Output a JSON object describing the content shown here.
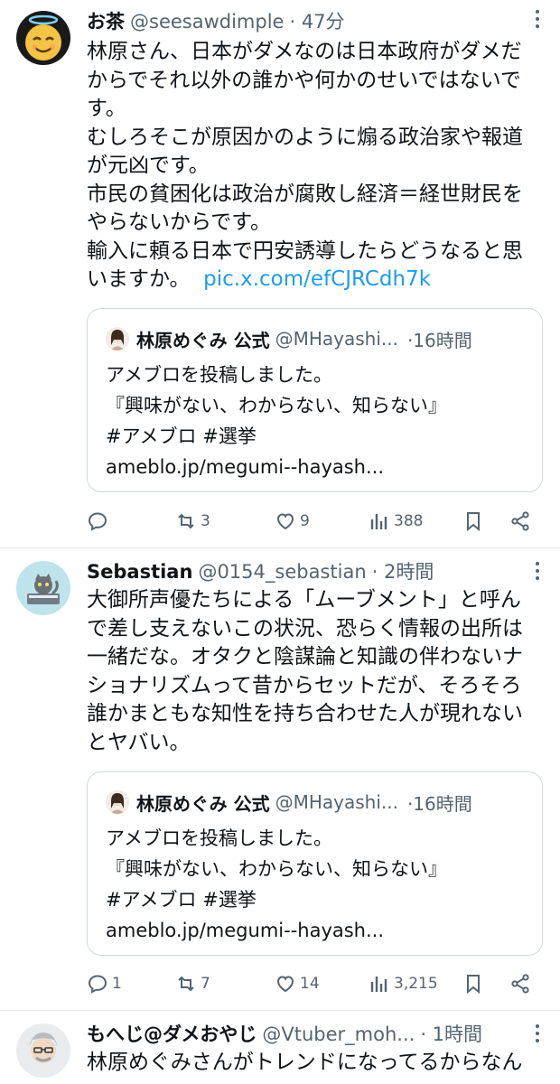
{
  "colors": {
    "link": "#1d9bf0",
    "secondary": "#536471",
    "border": "#cfd9de"
  },
  "tweets": [
    {
      "name": "お茶",
      "handle": "@seesawdimple",
      "time": "· 47分",
      "lines": [
        "林原さん、日本がダメなのは日本政府がダメだ",
        "からでそれ以外の誰かや何かのせいではないで",
        "す。",
        "むしろそこが原因かのように煽る政治家や報道",
        "が元凶です。",
        "市民の貧困化は政治が腐敗し経済＝経世財民を",
        "やらないからです。",
        "輸入に頼る日本で円安誘導したらどうなると思"
      ],
      "last_line": "いますか。",
      "link": "pic.x.com/efCJRCdh7k",
      "quote": {
        "name": "林原めぐみ 公式",
        "handle": "@MHayashi...",
        "time": "·16時間",
        "lines": [
          "アメブロを投稿しました。",
          "『興味がない、わからない、知らない』",
          "#アメブロ #選挙",
          "ameblo.jp/megumi--hayash..."
        ]
      },
      "replies": "",
      "retweets": "3",
      "likes": "9",
      "views": "388",
      "icons": [
        "reply-icon",
        "retweet-icon",
        "like-icon",
        "views-icon",
        "bookmark-icon",
        "share-icon"
      ]
    },
    {
      "name": "Sebastian",
      "handle": "@0154_sebastian",
      "time": "· 2時間",
      "lines": [
        "大御所声優たちによる「ムーブメント」と呼ん",
        "で差し支えないこの状況、恐らく情報の出所は",
        "一緒だな。オタクと陰謀論と知識の伴わないナ",
        "ショナリズムって昔からセットだが、そろそろ",
        "誰かまともな知性を持ち合わせた人が現れない",
        "とヤバい。"
      ],
      "quote": {
        "name": "林原めぐみ 公式",
        "handle": "@MHayashi...",
        "time": "·16時間",
        "lines": [
          "アメブロを投稿しました。",
          "『興味がない、わからない、知らない』",
          "#アメブロ #選挙",
          "ameblo.jp/megumi--hayash..."
        ]
      },
      "replies": "1",
      "retweets": "7",
      "likes": "14",
      "views": "3,215"
    },
    {
      "name": "もへじ@ダメおやじ",
      "handle": "@Vtuber_moh...",
      "time": "· 1時間",
      "lines": [
        "林原めぐみさんがトレンドになってるからなん"
      ]
    }
  ]
}
